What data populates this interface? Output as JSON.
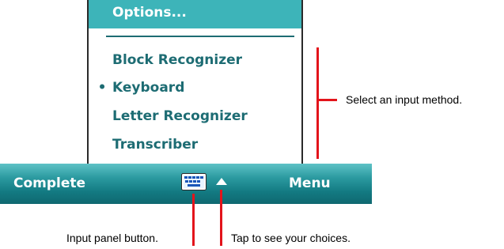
{
  "menu": {
    "header": "Options...",
    "items": [
      {
        "label": "Block Recognizer",
        "selected": false
      },
      {
        "label": "Keyboard",
        "selected": true
      },
      {
        "label": "Letter Recognizer",
        "selected": false
      },
      {
        "label": "Transcriber",
        "selected": false
      }
    ],
    "selected_marker": "•"
  },
  "taskbar": {
    "left_softkey": "Complete",
    "right_softkey": "Menu",
    "input_icon": "keyboard-icon",
    "arrow_icon": "up-arrow-icon"
  },
  "callouts": {
    "select_method": "Select an input method.",
    "input_panel": "Input panel button.",
    "tap_choices": "Tap to see your choices."
  },
  "colors": {
    "header_bg": "#3db4b9",
    "menu_text": "#1d6c73",
    "taskbar": "#137a82",
    "callout_line": "#e3141b"
  }
}
